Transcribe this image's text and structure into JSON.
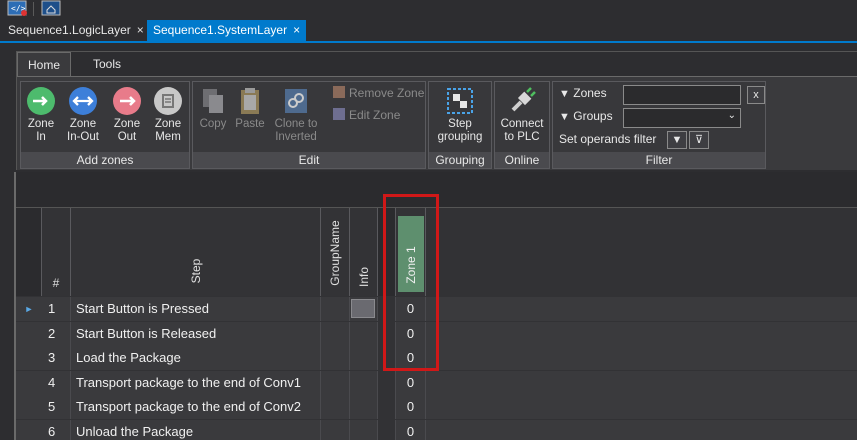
{
  "toolbar": {
    "icons": [
      "code-view-icon",
      "home-screen-icon"
    ]
  },
  "doc_tabs": [
    {
      "label": "Sequence1.LogicLayer",
      "close": "×"
    },
    {
      "label": "Sequence1.SystemLayer",
      "close": "×"
    }
  ],
  "ribbon": {
    "tabs": [
      "Home",
      "Tools"
    ],
    "groups": {
      "add_zones": {
        "title": "Add zones",
        "buttons": [
          {
            "label1": "Zone",
            "label2": "In"
          },
          {
            "label1": "Zone",
            "label2": "In-Out"
          },
          {
            "label1": "Zone",
            "label2": "Out"
          },
          {
            "label1": "Zone",
            "label2": "Mem"
          }
        ]
      },
      "edit": {
        "title": "Edit",
        "copy": "Copy",
        "paste": "Paste",
        "clone1": "Clone to",
        "clone2": "Inverted",
        "remove_zone": "Remove Zone",
        "edit_zone": "Edit Zone"
      },
      "grouping": {
        "title": "Grouping",
        "label1": "Step",
        "label2": "grouping"
      },
      "online": {
        "title": "Online",
        "label1": "Connect",
        "label2": "to PLC"
      },
      "filter": {
        "title": "Filter",
        "zones_label": "Zones",
        "groups_label": "Groups",
        "clear": "x",
        "set_operands": "Set operands filter"
      }
    }
  },
  "grid": {
    "headers": {
      "num": "#",
      "step": "Step",
      "group": "GroupName",
      "info": "Info",
      "zone1": "Zone 1"
    },
    "rows": [
      {
        "num": "1",
        "step": "Start Button is Pressed",
        "zone1": "0"
      },
      {
        "num": "2",
        "step": "Start Button is Released",
        "zone1": "0"
      },
      {
        "num": "3",
        "step": "Load the Package",
        "zone1": "0"
      },
      {
        "num": "4",
        "step": "Transport package to the end of Conv1",
        "zone1": "0"
      },
      {
        "num": "5",
        "step": "Transport package to the end of Conv2",
        "zone1": "0"
      },
      {
        "num": "6",
        "step": "Unload the Package",
        "zone1": "0"
      }
    ]
  },
  "colors": {
    "accent": "#007acc",
    "highlight": "#d01818",
    "zone_header": "#5e8f6e"
  }
}
